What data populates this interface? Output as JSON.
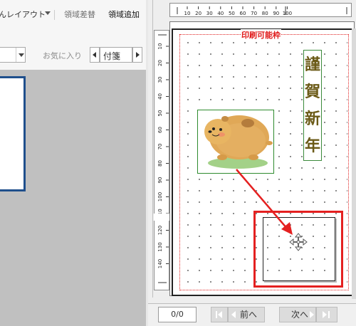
{
  "ribbon": {
    "layout_label": "んレイアウト",
    "region_swap_label": "領域差替",
    "region_add_label": "領域追加",
    "favorites_label": "お気に入り",
    "tag_label": "付箋"
  },
  "ruler": {
    "horizontal_ticks": [
      "10",
      "20",
      "30",
      "40",
      "50",
      "60",
      "70",
      "80",
      "90",
      "100"
    ],
    "vertical_ticks": [
      "10",
      "20",
      "30",
      "40",
      "50",
      "60",
      "70",
      "80",
      "90",
      "100",
      "110",
      "120",
      "130",
      "140"
    ]
  },
  "canvas": {
    "print_area_label": "印刷可能枠",
    "greeting_chars": [
      "謹",
      "賀",
      "新",
      "年"
    ]
  },
  "pager": {
    "counter": "0/0",
    "prev_label": "前へ",
    "next_label": "次へ"
  },
  "colors": {
    "accent_red": "#e42020",
    "frame_green": "#2e8b2e",
    "doc_blue": "#1f4f8c",
    "greeting_gold": "#6b5a17"
  },
  "icons": {
    "move_cursor": "four-way-arrow",
    "first_page": "skip-to-start",
    "last_page": "skip-to-end"
  }
}
